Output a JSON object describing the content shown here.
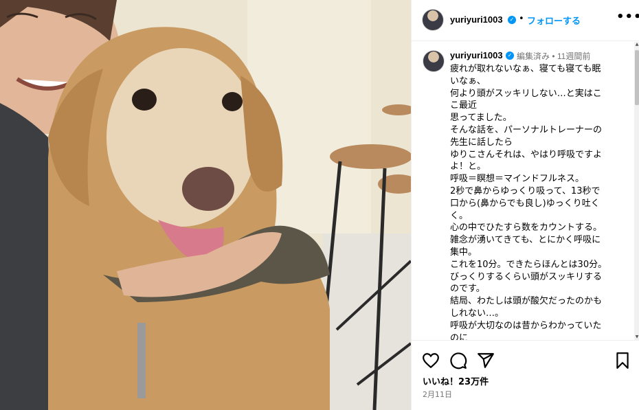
{
  "post": {
    "username": "yuriyuri1003",
    "follow_label": "フォローする",
    "separator": "•",
    "more_label": "•••"
  },
  "caption": {
    "username": "yuriyuri1003",
    "meta": "編集済み • 11週間前",
    "lines": [
      "疲れが取れないなぁ、寝ても寝ても眠",
      "いなぁ、",
      "何より頭がスッキリしない…と実はこ",
      "こ最近",
      "思ってました。",
      "そんな話を、パーソナルトレーナーの",
      "先生に話したら",
      "ゆりこさんそれは、やはり呼吸ですよ",
      "よ！と。",
      "呼吸＝瞑想＝マインドフルネス。",
      "2秒で鼻からゆっくり吸って、13秒で",
      "口から(鼻からでも良し)ゆっくり吐く",
      "く。",
      "心の中でひたすら数をカウントする。",
      "雑念が湧いてきても、とにかく呼吸に",
      "集中。",
      "これを10分。できたらほんとは30分。",
      "びっくりするくらい頭がスッキリする",
      "のです。",
      "結局、わたしは頭が酸欠だったのかも",
      "しれない…。",
      "呼吸が大切なのは昔からわかっていた",
      "のに"
    ]
  },
  "footer": {
    "likes": "いいね！23万件",
    "date": "2月11日"
  },
  "icons": {
    "like": "heart-icon",
    "comment": "comment-icon",
    "share": "share-icon",
    "save": "bookmark-icon",
    "verified": "verified-badge-icon"
  },
  "colors": {
    "accent": "#0095f6",
    "muted": "#737373",
    "border": "#efefef"
  }
}
